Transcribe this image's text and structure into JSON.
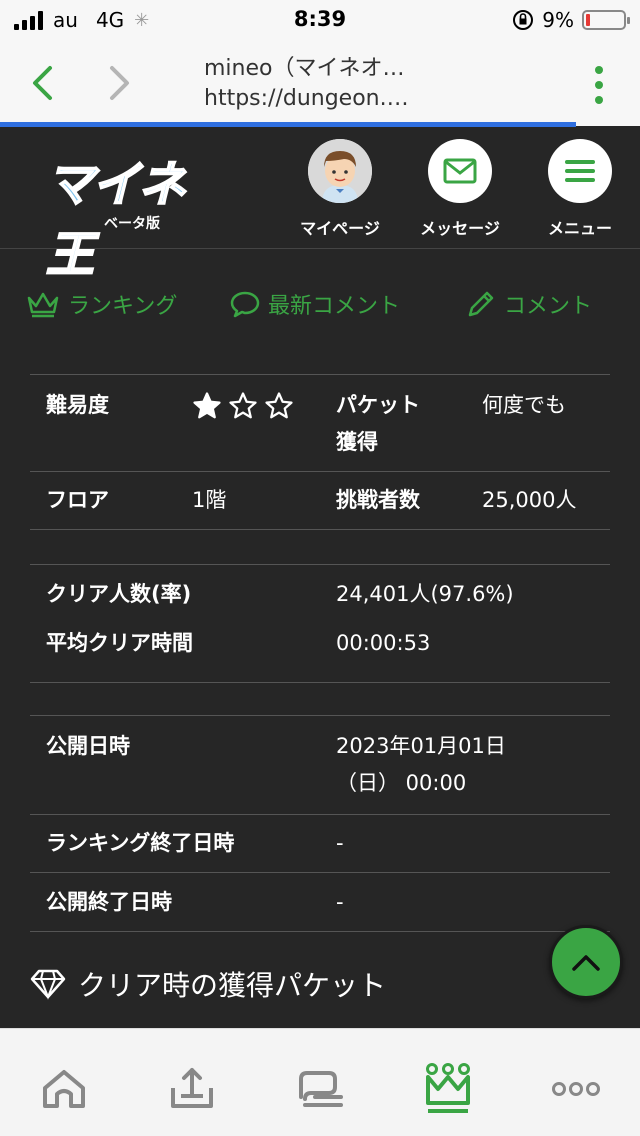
{
  "status_bar": {
    "carrier": "au",
    "network": "4G",
    "time": "8:39",
    "battery": "9%"
  },
  "browser": {
    "page_title": "mineo（マイネオ…",
    "url": "https://dungeon.…",
    "load_progress": 0.9,
    "accent": "#3aa544"
  },
  "header": {
    "logo_text": "マイネ王",
    "logo_sub": "ベータ版",
    "mypage_label": "マイページ",
    "message_label": "メッセージ",
    "menu_label": "メニュー"
  },
  "tabs": {
    "ranking": "ランキング",
    "latest_comments": "最新コメント",
    "comment": "コメント"
  },
  "info": {
    "difficulty_label": "難易度",
    "difficulty_stars": 1,
    "difficulty_max": 3,
    "packet_label_1": "パケット",
    "packet_label_2": "獲得",
    "packet_value": "何度でも",
    "floor_label": "フロア",
    "floor_value": "1階",
    "challengers_label": "挑戦者数",
    "challengers_value": "25,000人",
    "clear_count_label": "クリア人数(率)",
    "clear_count_value": "24,401人(97.6%)",
    "avg_clear_label": "平均クリア時間",
    "avg_clear_value": "00:00:53",
    "published_label": "公開日時",
    "published_value_1": "2023年01月01日",
    "published_value_2": "（日） 00:00",
    "ranking_end_label": "ランキング終了日時",
    "ranking_end_value": "-",
    "publish_end_label": "公開終了日時",
    "publish_end_value": "-"
  },
  "section": {
    "clear_packet_title": "クリア時の獲得パケット"
  },
  "bottom_nav": {
    "icons": [
      "home-icon",
      "upload-tray-icon",
      "chat-icon",
      "crown-icon",
      "more-icon"
    ]
  }
}
